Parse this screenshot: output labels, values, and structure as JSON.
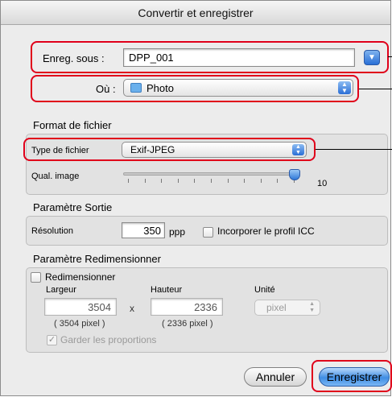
{
  "window": {
    "title": "Convertir et enregistrer"
  },
  "save_as": {
    "label": "Enreg. sous :",
    "value": "DPP_001"
  },
  "where": {
    "label": "Où :",
    "value": "Photo"
  },
  "file_format": {
    "section_title": "Format de fichier",
    "file_type_label": "Type de fichier",
    "file_type_value": "Exif-JPEG",
    "quality_label": "Qual. image",
    "quality_value": "10",
    "quality_fraction": 1.0
  },
  "output": {
    "section_title": "Paramètre Sortie",
    "resolution_label": "Résolution",
    "resolution_value": "350",
    "resolution_unit": "ppp",
    "icc_label": "Incorporer le profil ICC",
    "icc_checked": false
  },
  "resize": {
    "section_title": "Paramètre Redimensionner",
    "checkbox_label": "Redimensionner",
    "checked": false,
    "width_label": "Largeur",
    "height_label": "Hauteur",
    "unit_label": "Unité",
    "width_value": "3504",
    "height_value": "2336",
    "separator": "x",
    "unit_value": "pixel",
    "width_pixels": "( 3504 pixel )",
    "height_pixels": "( 2336 pixel )",
    "keep_proportions_label": "Garder les proportions",
    "keep_proportions_checked": true
  },
  "buttons": {
    "cancel": "Annuler",
    "save": "Enregistrer"
  },
  "colors": {
    "highlight": "#e0001a",
    "accent": "#3f8de3"
  }
}
